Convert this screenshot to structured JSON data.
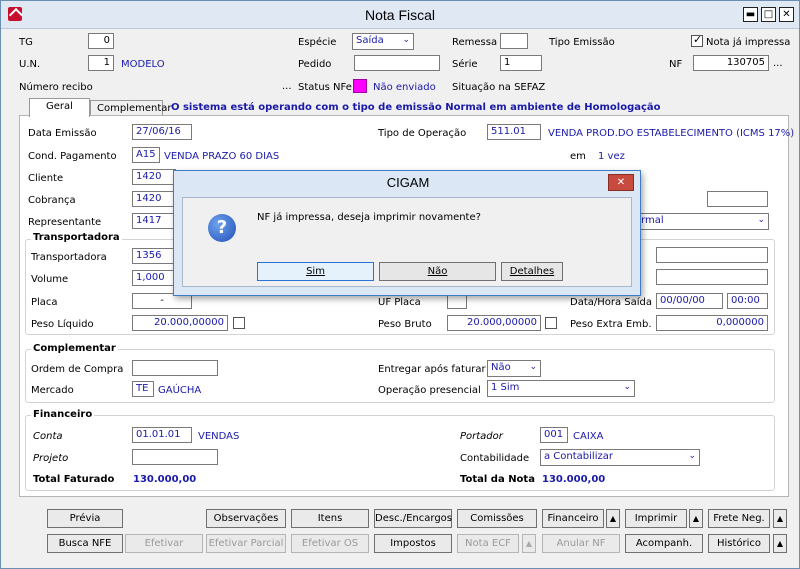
{
  "window": {
    "title": "Nota Fiscal"
  },
  "header": {
    "tg_label": "TG",
    "tg_value": "0",
    "un_label": "U.N.",
    "un_value": "1",
    "un_name": "MODELO",
    "especie_label": "Espécie",
    "especie_value": "Saída",
    "remessa_label": "Remessa",
    "remessa_value": "",
    "tipo_emissao_label": "Tipo Emissão",
    "nf_impressa_label": "Nota já impressa",
    "nf_impressa_checked": true,
    "pedido_label": "Pedido",
    "pedido_value": "",
    "serie_label": "Série",
    "serie_value": "1",
    "nf_label": "NF",
    "nf_value": "130705",
    "numero_recibo_label": "Número recibo",
    "status_nfe_label": "Status NFe",
    "status_nfe_value": "Não enviado",
    "status_color": "#ff00ff",
    "situacao_label": "Situação na SEFAZ",
    "ellipsis": "..."
  },
  "tabs": [
    {
      "label": "Geral"
    },
    {
      "label": "Complementar"
    }
  ],
  "tab_notice": "O sistema está operando com o tipo de emissão Normal em ambiente de Homologação",
  "geral": {
    "data_emissao_label": "Data Emissão",
    "data_emissao_value": "27/06/16",
    "tipo_operacao_label": "Tipo de Operação",
    "tipo_operacao_code": "511.01",
    "tipo_operacao_desc": "VENDA PROD.DO ESTABELECIMENTO (ICMS 17%)",
    "cond_pagamento_label": "Cond. Pagamento",
    "cond_pagamento_code": "A15",
    "cond_pagamento_desc": "VENDA PRAZO 60 DIAS",
    "em_label": "em",
    "em_value": "1 vez",
    "cliente_label": "Cliente",
    "cliente_value": "1420",
    "cobranca_label": "Cobrança",
    "cobranca_value": "1420",
    "representante_label": "Representante",
    "representante_value": "1417",
    "representante_combo_tail": "ormal"
  },
  "transportadora": {
    "title": "Transportadora",
    "transportadora_label": "Transportadora",
    "transportadora_value": "1356",
    "volume_label": "Volume",
    "volume_value": "1,000",
    "placa_label": "Placa",
    "placa_value": "-",
    "uf_placa_label": "UF Placa",
    "uf_placa_value": "",
    "data_hora_saida_label": "Data/Hora Saída",
    "data_saida_value": "00/00/00",
    "hora_saida_value": "00:00",
    "peso_liquido_label": "Peso Líquido",
    "peso_liquido_value": "20.000,00000",
    "peso_bruto_label": "Peso Bruto",
    "peso_bruto_value": "20.000,00000",
    "peso_extra_label": "Peso Extra Emb.",
    "peso_extra_value": "0,000000"
  },
  "complementar": {
    "title": "Complementar",
    "ordem_compra_label": "Ordem de Compra",
    "ordem_compra_value": "",
    "entregar_label": "Entregar após faturar",
    "entregar_value": "Não",
    "mercado_label": "Mercado",
    "mercado_code": "TE",
    "mercado_desc": "GAÚCHA",
    "operacao_presencial_label": "Operação presencial",
    "operacao_presencial_value": "1 Sim"
  },
  "financeiro": {
    "title": "Financeiro",
    "conta_label": "Conta",
    "conta_code": "01.01.01",
    "conta_desc": "VENDAS",
    "portador_label": "Portador",
    "portador_code": "001",
    "portador_desc": "CAIXA",
    "projeto_label": "Projeto",
    "projeto_value": "",
    "contabilidade_label": "Contabilidade",
    "contabilidade_value": "a Contabilizar",
    "total_faturado_label": "Total Faturado",
    "total_faturado_value": "130.000,00",
    "total_nota_label": "Total da Nota",
    "total_nota_value": "130.000,00"
  },
  "toolbar": {
    "previa": "Prévia",
    "observacoes": "Observações",
    "itens": "Itens",
    "desc_encargos": "Desc./Encargos",
    "comissoes": "Comissões",
    "financeiro": "Financeiro",
    "imprimir": "Imprimir",
    "frete_neg": "Frete Neg.",
    "busca_nfe": "Busca NFE",
    "efetivar": "Efetivar",
    "efetivar_parcial": "Efetivar Parcial",
    "efetivar_os": "Efetivar OS",
    "impostos": "Impostos",
    "nota_ecf": "Nota ECF",
    "anular_nf": "Anular NF",
    "acompanh": "Acompanh.",
    "historico": "Histórico"
  },
  "dialog": {
    "title": "CIGAM",
    "message": "NF já impressa, deseja imprimir novamente?",
    "sim": "Sim",
    "nao": "Não",
    "detalhes": "Detalhes"
  }
}
